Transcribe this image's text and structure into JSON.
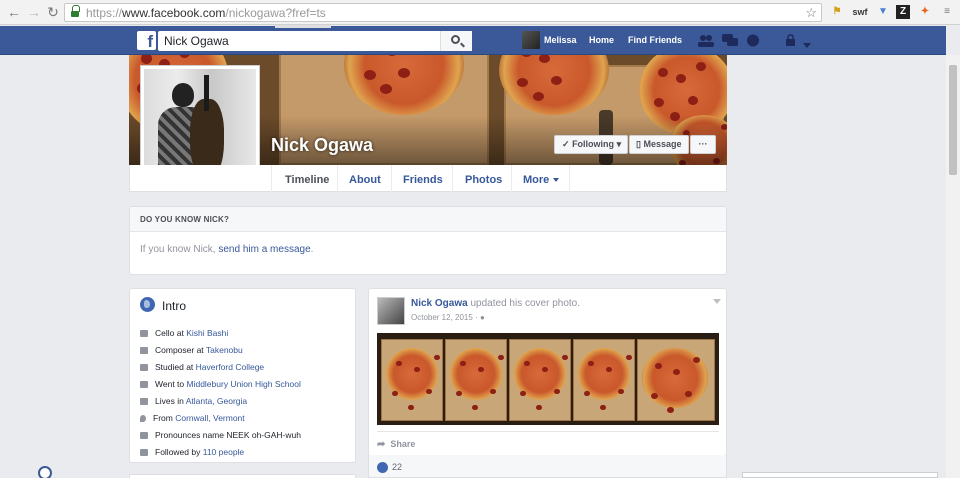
{
  "browser": {
    "url_protocol": "https://",
    "url_host": "www.facebook.com",
    "url_path": "/nickogawa?fref=ts",
    "back_icon": "back-arrow-icon",
    "forward_icon": "forward-arrow-icon",
    "reload_icon": "reload-icon",
    "bookmark_icon": "star-icon",
    "extensions": [
      "ext1",
      "swf",
      "ext3",
      "ext4",
      "ext5"
    ]
  },
  "topnav": {
    "search_value": "Nick Ogawa",
    "user_name": "Melissa",
    "home": "Home",
    "find_friends": "Find Friends",
    "brand_color": "#3b5998"
  },
  "profile": {
    "name": "Nick Ogawa",
    "following_label": "Following",
    "message_label": "Message",
    "more_label": "···",
    "tabs": [
      {
        "label": "Timeline"
      },
      {
        "label": "About"
      },
      {
        "label": "Friends"
      },
      {
        "label": "Photos"
      },
      {
        "label": "More"
      }
    ]
  },
  "dyk": {
    "title": "DO YOU KNOW NICK?",
    "text_prefix": "If you know Nick, ",
    "link": "send him a message",
    "suffix": "."
  },
  "intro": {
    "title": "Intro",
    "rows": [
      {
        "prefix": "Cello at ",
        "link": "Kishi Bashi",
        "icon": "briefcase-icon"
      },
      {
        "prefix": "Composer at ",
        "link": "Takenobu",
        "icon": "briefcase-icon"
      },
      {
        "prefix": "Studied at ",
        "link": "Haverford College",
        "icon": "graduation-cap-icon"
      },
      {
        "prefix": "Went to ",
        "link": "Middlebury Union High School",
        "icon": "graduation-cap-icon"
      },
      {
        "prefix": "Lives in ",
        "link": "Atlanta, Georgia",
        "icon": "home-icon"
      },
      {
        "prefix": "From ",
        "link": "Cornwall, Vermont",
        "icon": "location-pin-icon"
      },
      {
        "prefix": "Pronounces name NEEK oh-GAH-wuh",
        "link": "",
        "icon": "speaker-icon"
      },
      {
        "prefix": "Followed by ",
        "link": "110 people",
        "icon": "rss-icon"
      }
    ]
  },
  "post": {
    "author": "Nick Ogawa",
    "action": " updated his cover photo.",
    "date": "October 12, 2015 · ",
    "share_label": "Share",
    "likes": "22"
  }
}
